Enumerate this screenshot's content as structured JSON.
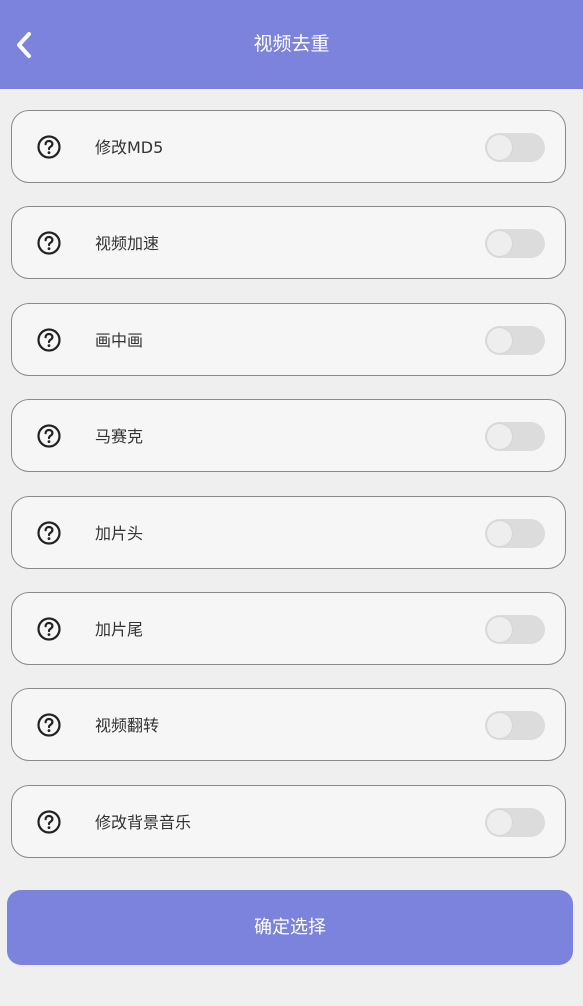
{
  "header": {
    "title": "视频去重",
    "back_icon": "chevron-left-icon"
  },
  "colors": {
    "accent": "#7c83dd",
    "background": "#efefef",
    "toggle_off": "#dcdcdc"
  },
  "options": [
    {
      "label": "修改MD5",
      "enabled": false,
      "icon": "question-circle-icon"
    },
    {
      "label": "视频加速",
      "enabled": false,
      "icon": "question-circle-icon"
    },
    {
      "label": "画中画",
      "enabled": false,
      "icon": "question-circle-icon"
    },
    {
      "label": "马赛克",
      "enabled": false,
      "icon": "question-circle-icon"
    },
    {
      "label": "加片头",
      "enabled": false,
      "icon": "question-circle-icon"
    },
    {
      "label": "加片尾",
      "enabled": false,
      "icon": "question-circle-icon"
    },
    {
      "label": "视频翻转",
      "enabled": false,
      "icon": "question-circle-icon"
    },
    {
      "label": "修改背景音乐",
      "enabled": false,
      "icon": "question-circle-icon"
    }
  ],
  "footer": {
    "confirm_label": "确定选择"
  }
}
